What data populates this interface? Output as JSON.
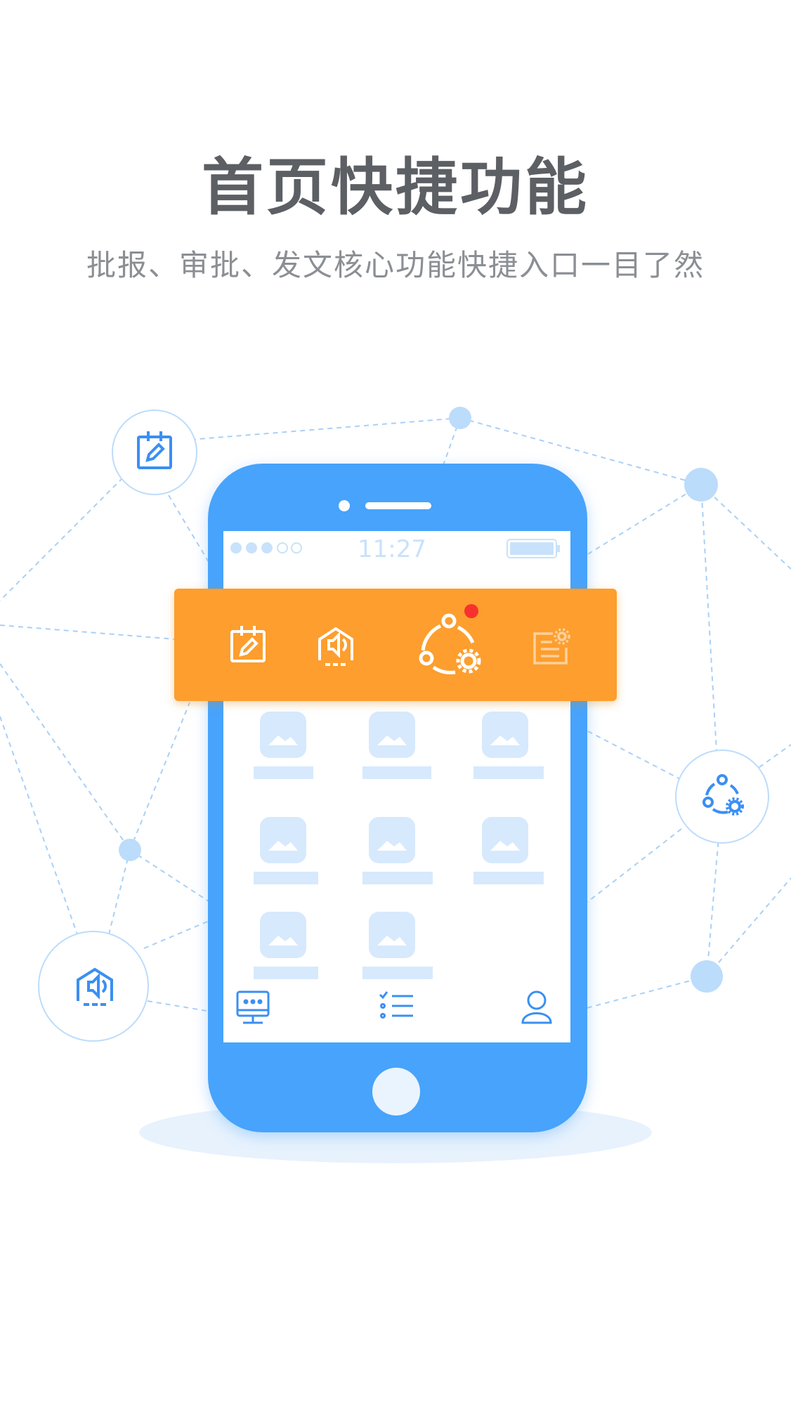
{
  "title": "首页快捷功能",
  "subtitle": "批报、审批、发文核心功能快捷入口一目了然",
  "phone": {
    "status_time": "11:27",
    "quick_bar_icons": [
      "report-edit-icon",
      "announcement-house-icon",
      "workflow-settings-icon",
      "document-settings-icon"
    ],
    "bottom_nav_icons": [
      "desktop-apps-icon",
      "task-list-icon",
      "user-profile-icon"
    ]
  },
  "floating_icons": [
    "report-edit-icon",
    "workflow-settings-icon",
    "announcement-house-icon"
  ],
  "colors": {
    "phone_blue": "#47a3fb",
    "quick_bar_orange": "#fd9e2f",
    "badge_red": "#f7322e",
    "light_blue": "#b8dafb",
    "text_dark": "#5c5f63",
    "text_gray": "#8b8f94"
  }
}
